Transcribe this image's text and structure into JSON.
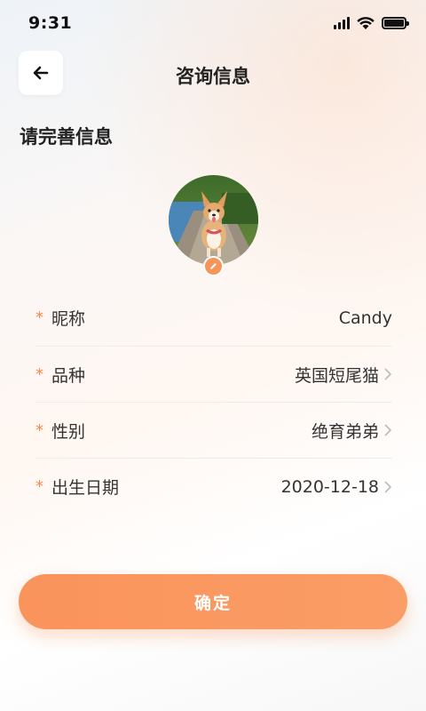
{
  "status_bar": {
    "time": "9:31"
  },
  "header": {
    "title": "咨询信息"
  },
  "section": {
    "title": "请完善信息"
  },
  "form": {
    "rows": [
      {
        "required_mark": "*",
        "label": "昵称",
        "value": "Candy",
        "has_chevron": false
      },
      {
        "required_mark": "*",
        "label": "品种",
        "value": "英国短尾猫",
        "has_chevron": true
      },
      {
        "required_mark": "*",
        "label": "性别",
        "value": "绝育弟弟",
        "has_chevron": true
      },
      {
        "required_mark": "*",
        "label": "出生日期",
        "value": "2020-12-18",
        "has_chevron": true
      }
    ]
  },
  "actions": {
    "confirm_label": "确定"
  },
  "icons": {
    "back": "arrow-left-icon",
    "edit": "pencil-icon",
    "chevron": "chevron-right-icon",
    "signal": "cellular-signal-icon",
    "wifi": "wifi-icon",
    "battery": "battery-icon"
  },
  "colors": {
    "accent": "#F5955A",
    "required": "#F08A4B",
    "text": "#333333"
  }
}
